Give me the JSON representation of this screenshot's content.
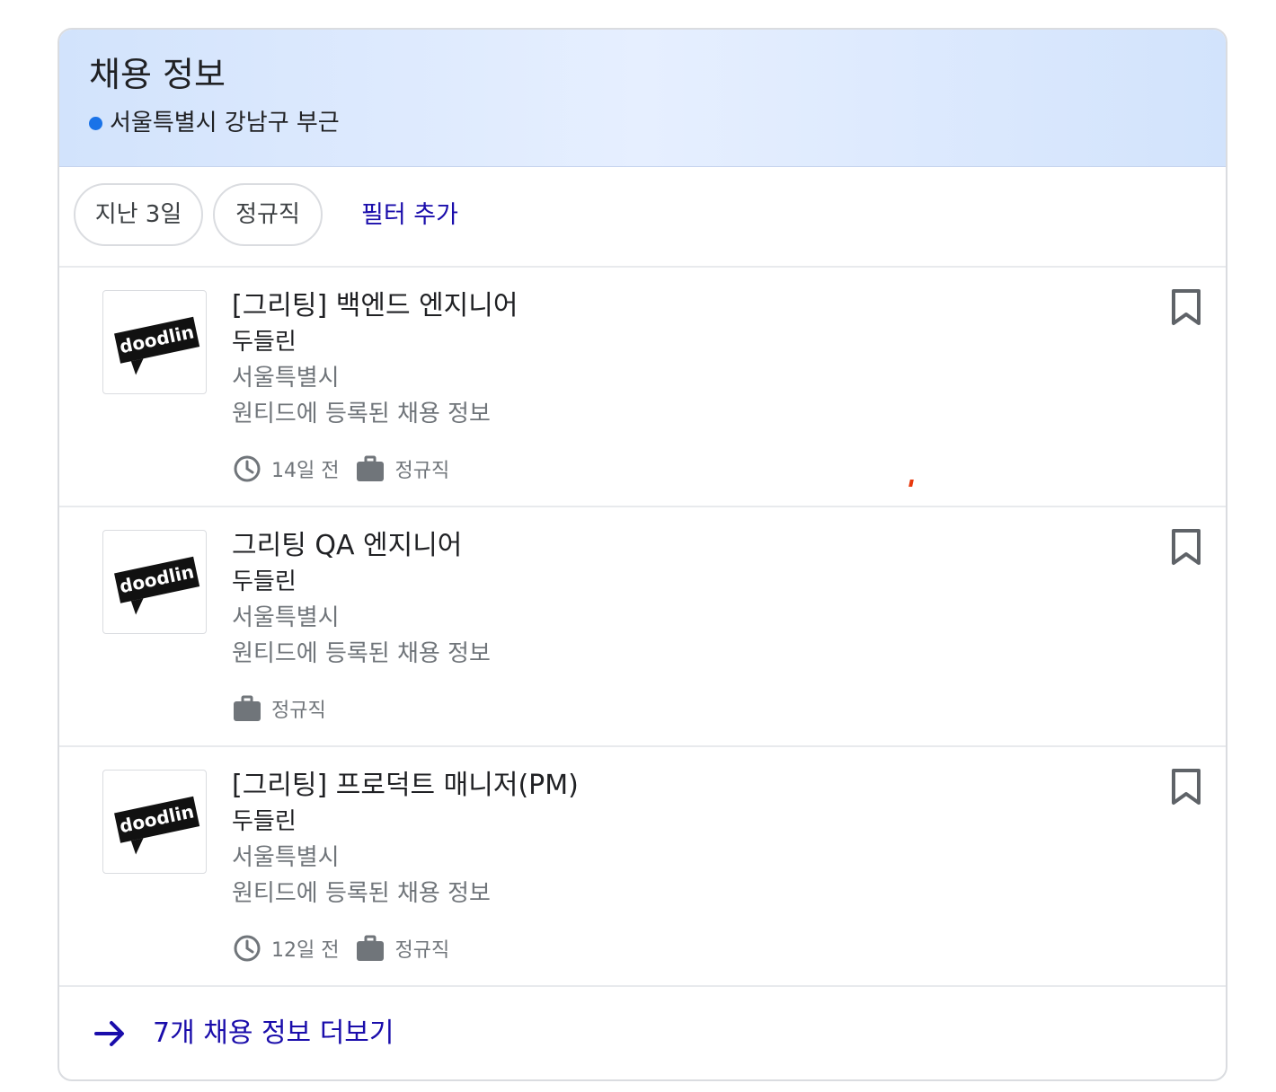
{
  "header": {
    "title": "채용 정보",
    "location": "서울특별시 강남구 부근",
    "accent_color": "#1a73e8"
  },
  "filters": {
    "chips": [
      "지난 3일",
      "정규직"
    ],
    "add_filter_label": "필터 추가"
  },
  "jobs": [
    {
      "title": "[그리팅] 백엔드 엔지니어",
      "company": "두들린",
      "location": "서울특별시",
      "via": "원티드에 등록된 채용 정보",
      "posted": "14일 전",
      "type": "정규직",
      "logo_text": "doodlin",
      "icons": [
        "clock-icon",
        "briefcase-icon",
        "bookmark-icon"
      ]
    },
    {
      "title": "그리팅 QA 엔지니어",
      "company": "두들린",
      "location": "서울특별시",
      "via": "원티드에 등록된 채용 정보",
      "type": "정규직",
      "logo_text": "doodlin",
      "icons": [
        "briefcase-icon",
        "bookmark-icon"
      ]
    },
    {
      "title": "[그리팅] 프로덕트 매니저(PM)",
      "company": "두들린",
      "location": "서울특별시",
      "via": "원티드에 등록된 채용 정보",
      "posted": "12일 전",
      "type": "정규직",
      "logo_text": "doodlin",
      "icons": [
        "clock-icon",
        "briefcase-icon",
        "bookmark-icon"
      ]
    }
  ],
  "more": {
    "label": "7개 채용 정보 더보기",
    "link_color": "#1a0dab"
  }
}
